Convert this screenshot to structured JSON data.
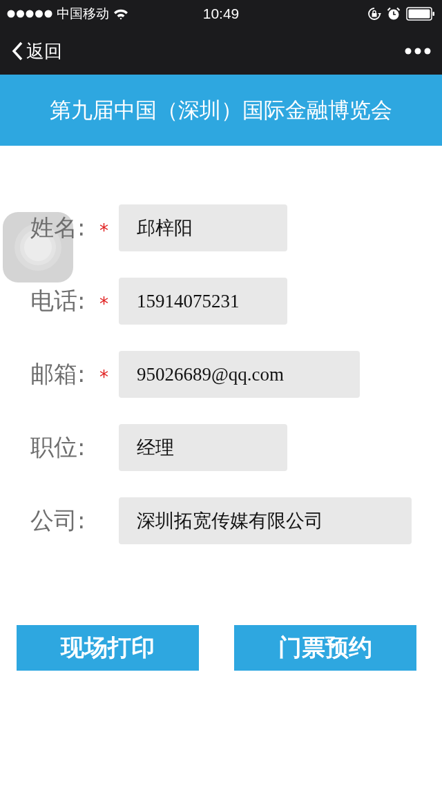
{
  "status_bar": {
    "carrier": "中国移动",
    "time": "10:49"
  },
  "nav_bar": {
    "back": "返回"
  },
  "header": {
    "title": "第九届中国（深圳）国际金融博览会"
  },
  "form": {
    "fields": [
      {
        "label": "姓名:",
        "required_mark": "*",
        "value": "邱梓阳",
        "kind": "short"
      },
      {
        "label": "电话:",
        "required_mark": "*",
        "value": "15914075231",
        "kind": "short"
      },
      {
        "label": "邮箱:",
        "required_mark": "*",
        "value": "95026689@qq.com",
        "kind": "medium"
      },
      {
        "label": "职位:",
        "value": "经理",
        "kind": "short"
      },
      {
        "label": "公司:",
        "value": "深圳拓宽传媒有限公司",
        "kind": "long"
      }
    ]
  },
  "buttons": [
    "现场打印",
    "门票预约"
  ]
}
